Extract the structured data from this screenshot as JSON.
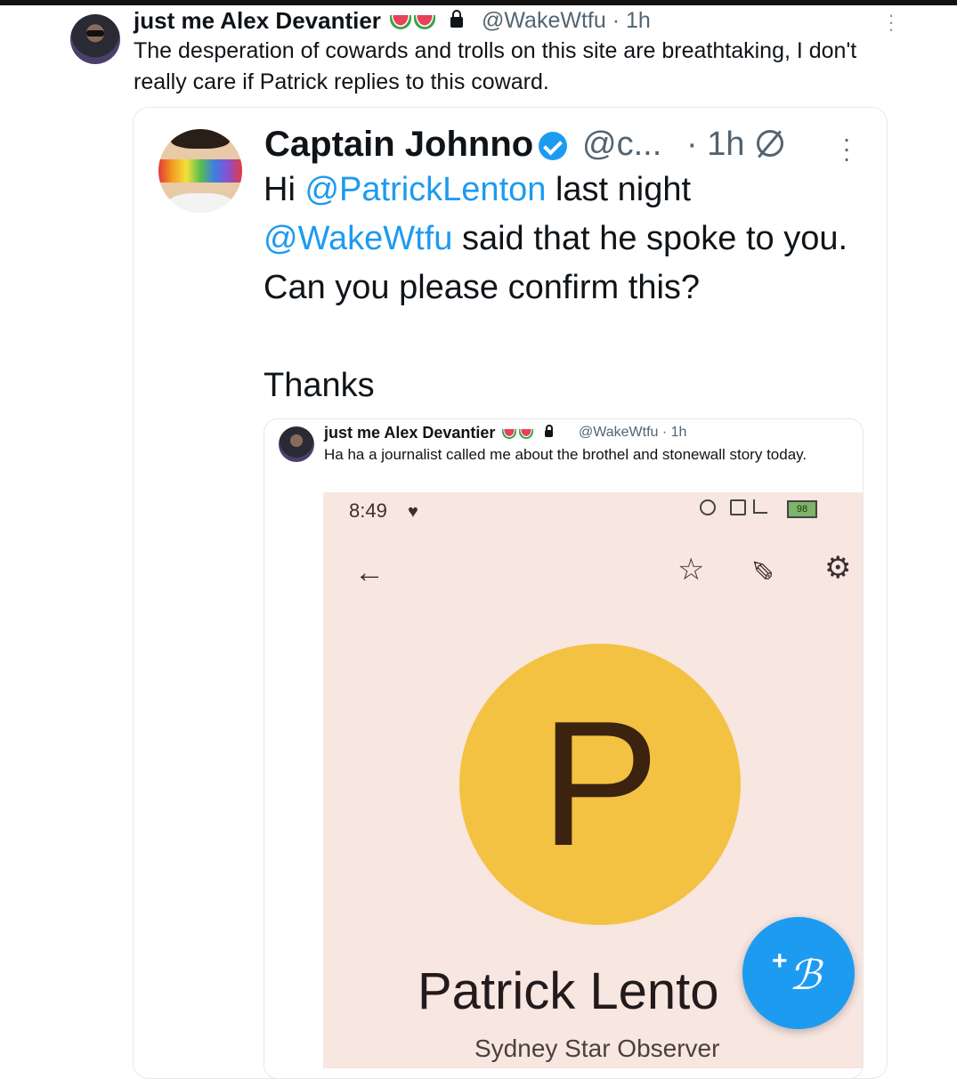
{
  "outer_tweet": {
    "display_name": "just me Alex Devantier",
    "handle": "@WakeWtfu",
    "time": "· 1h",
    "text": "The desperation of cowards and trolls on this site are breathtaking, I don't really care if Patrick replies to this coward."
  },
  "quoted_tweet": {
    "display_name": "Captain Johnno",
    "handle": "@c...",
    "time": "· 1h",
    "body_hi": "Hi ",
    "mention1": "@PatrickLenton",
    "body_mid": " last night",
    "mention2": "@WakeWtfu",
    "body_rest": " said that he spoke to you. Can you please confirm this?\n\nThanks"
  },
  "embedded_tweet": {
    "display_name": "just me Alex Devantier",
    "handle": "@WakeWtfu · 1h",
    "text": "Ha ha a journalist called me about the brothel and stonewall story today."
  },
  "phone_screen": {
    "clock": "8:49",
    "battery": "98",
    "contact_initial": "P",
    "contact_name": "Patrick Lento",
    "contact_org": "Sydney Star Observer"
  },
  "icons": [
    "watermelon-emoji",
    "lock-icon",
    "verified-badge-icon",
    "mute-icon",
    "more-icon",
    "heart-icon",
    "back-arrow-icon",
    "star-icon",
    "edit-pencil-icon",
    "settings-icon",
    "compose-icon"
  ],
  "colors": {
    "link": "#1d9bf0",
    "muted": "#536471",
    "avatar_yellow": "#f3c242",
    "phone_bg": "#f8e6e1"
  }
}
